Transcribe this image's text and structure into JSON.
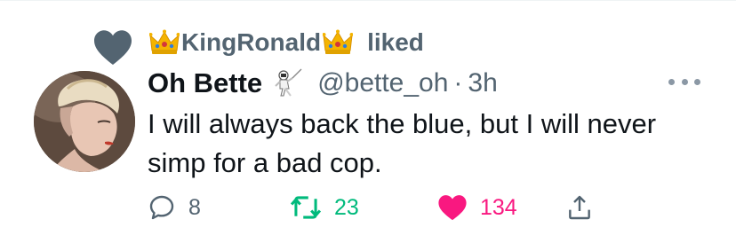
{
  "social_context": {
    "icon": "heart-icon",
    "user_name": "KingRonald",
    "user_emoji_left": "crown-emoji",
    "user_emoji_right": "crown-emoji",
    "action": "liked"
  },
  "tweet": {
    "display_name": "Oh Bette",
    "name_emoji": "fencer-emoji",
    "handle": "@bette_oh",
    "separator": "·",
    "time": "3h",
    "text": "I will always back the blue, but I will never simp for a bad cop."
  },
  "actions": {
    "reply_count": "8",
    "retweet_count": "23",
    "like_count": "134"
  },
  "colors": {
    "secondary_text": "#536471",
    "retweet_green": "#00ba7c",
    "like_pink": "#f91880",
    "context_heart": "#536471"
  }
}
